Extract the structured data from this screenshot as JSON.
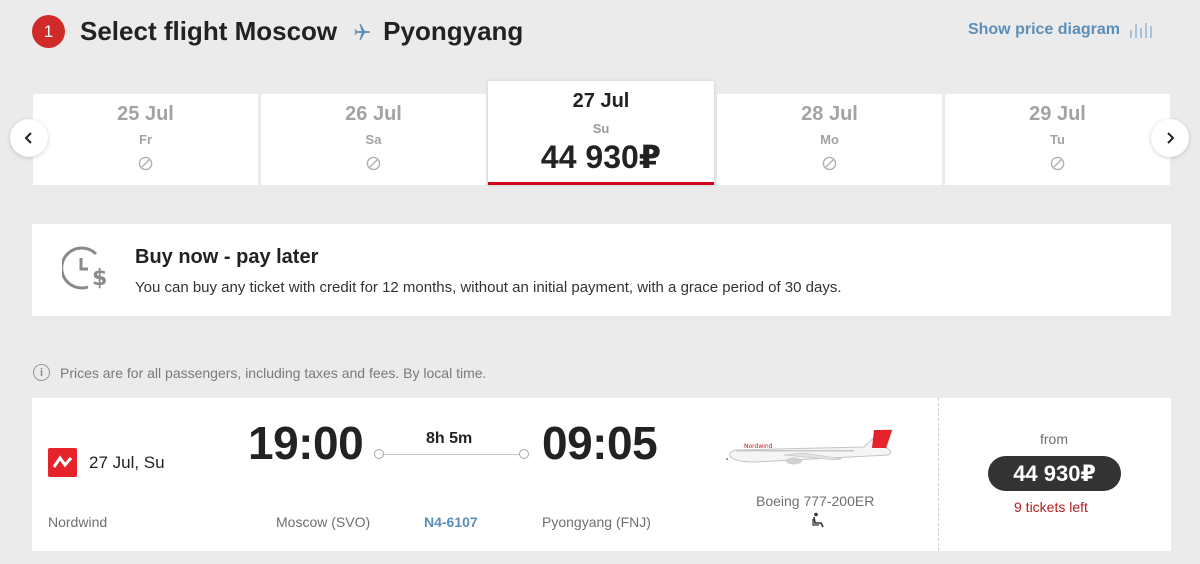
{
  "header": {
    "step": "1",
    "title_prefix": "Select flight Moscow",
    "title_suffix": "Pyongyang",
    "price_diagram_label": "Show price diagram"
  },
  "dates": [
    {
      "date": "25 Jul",
      "weekday": "Fr",
      "price": null
    },
    {
      "date": "26 Jul",
      "weekday": "Sa",
      "price": null
    },
    {
      "date": "27 Jul",
      "weekday": "Su",
      "price": "44 930₽",
      "selected": true
    },
    {
      "date": "28 Jul",
      "weekday": "Mo",
      "price": null
    },
    {
      "date": "29 Jul",
      "weekday": "Tu",
      "price": null
    }
  ],
  "promo": {
    "title": "Buy now - pay later",
    "text": "You can buy any ticket with credit for 12 months, without an initial payment, with a grace period of 30 days."
  },
  "info_text": "Prices are for all passengers, including taxes and fees. By local time.",
  "flight": {
    "date": "27 Jul, Su",
    "airline": "Nordwind",
    "departure_time": "19:00",
    "arrival_time": "09:05",
    "duration": "8h 5m",
    "departure_airport": "Moscow (SVO)",
    "arrival_airport": "Pyongyang (FNJ)",
    "flight_number": "N4-6107",
    "aircraft": "Boeing 777-200ER",
    "from_label": "from",
    "price": "44 930₽",
    "tickets_left": "9 tickets left"
  },
  "colors": {
    "accent_red": "#d0021b",
    "link_blue": "#5b8fb9",
    "background": "#ebebeb"
  },
  "icons": [
    "plane-icon",
    "bar-chart-icon",
    "chevron-left-icon",
    "chevron-right-icon",
    "unavailable-icon",
    "clock-dollar-icon",
    "info-icon",
    "nordwind-logo",
    "seat-icon"
  ]
}
